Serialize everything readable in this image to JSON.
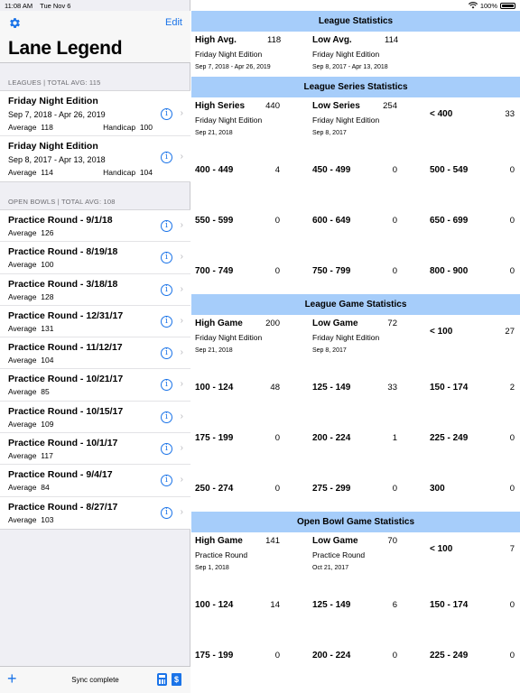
{
  "status": {
    "time": "11:08 AM",
    "date": "Tue Nov 6",
    "battery": "100%"
  },
  "sidebar": {
    "edit_label": "Edit",
    "title": "Lane Legend",
    "leagues_header": "LEAGUES | TOTAL AVG: 115",
    "leagues": [
      {
        "name": "Friday Night Edition",
        "dates": "Sep 7, 2018 - Apr 26, 2019",
        "average_label": "Average",
        "average": "118",
        "handicap_label": "Handicap",
        "handicap": "100"
      },
      {
        "name": "Friday Night Edition",
        "dates": "Sep 8, 2017 - Apr 13, 2018",
        "average_label": "Average",
        "average": "114",
        "handicap_label": "Handicap",
        "handicap": "104"
      }
    ],
    "open_header": "OPEN BOWLS | TOTAL AVG: 108",
    "open_bowls": [
      {
        "name": "Practice Round - 9/1/18",
        "average_label": "Average",
        "average": "126"
      },
      {
        "name": "Practice Round - 8/19/18",
        "average_label": "Average",
        "average": "100"
      },
      {
        "name": "Practice Round - 3/18/18",
        "average_label": "Average",
        "average": "128"
      },
      {
        "name": "Practice Round - 12/31/17",
        "average_label": "Average",
        "average": "131"
      },
      {
        "name": "Practice Round - 11/12/17",
        "average_label": "Average",
        "average": "104"
      },
      {
        "name": "Practice Round  - 10/21/17",
        "average_label": "Average",
        "average": "85"
      },
      {
        "name": "Practice Round - 10/15/17",
        "average_label": "Average",
        "average": "109"
      },
      {
        "name": "Practice Round - 10/1/17",
        "average_label": "Average",
        "average": "117"
      },
      {
        "name": "Practice Round - 9/4/17",
        "average_label": "Average",
        "average": "84"
      },
      {
        "name": "Practice Round - 8/27/17",
        "average_label": "Average",
        "average": "103"
      }
    ],
    "sync_status": "Sync complete"
  },
  "main": {
    "league_stats": {
      "title": "League Statistics",
      "high_label": "High Avg.",
      "high_value": "118",
      "high_league": "Friday Night Edition",
      "high_dates": "Sep 7, 2018 - Apr 26, 2019",
      "low_label": "Low Avg.",
      "low_value": "114",
      "low_league": "Friday Night Edition",
      "low_dates": "Sep 8, 2017 - Apr 13, 2018"
    },
    "series_stats": {
      "title": "League Series Statistics",
      "high_label": "High Series",
      "high_value": "440",
      "high_league": "Friday Night Edition",
      "high_date": "Sep 21, 2018",
      "low_label": "Low Series",
      "low_value": "254",
      "low_league": "Friday Night Edition",
      "low_date": "Sep 8, 2017",
      "first_range": {
        "label": "< 400",
        "count": "33"
      },
      "ranges": [
        {
          "label": "400 - 449",
          "count": "4"
        },
        {
          "label": "450 - 499",
          "count": "0"
        },
        {
          "label": "500 - 549",
          "count": "0"
        },
        {
          "label": "550 - 599",
          "count": "0"
        },
        {
          "label": "600 - 649",
          "count": "0"
        },
        {
          "label": "650 - 699",
          "count": "0"
        },
        {
          "label": "700 - 749",
          "count": "0"
        },
        {
          "label": "750 - 799",
          "count": "0"
        },
        {
          "label": "800 - 900",
          "count": "0"
        }
      ]
    },
    "game_stats": {
      "title": "League Game Statistics",
      "high_label": "High Game",
      "high_value": "200",
      "high_league": "Friday Night Edition",
      "high_date": "Sep 21, 2018",
      "low_label": "Low Game",
      "low_value": "72",
      "low_league": "Friday Night Edition",
      "low_date": "Sep 8, 2017",
      "first_range": {
        "label": "< 100",
        "count": "27"
      },
      "ranges": [
        {
          "label": "100 - 124",
          "count": "48"
        },
        {
          "label": "125 - 149",
          "count": "33"
        },
        {
          "label": "150 - 174",
          "count": "2"
        },
        {
          "label": "175 - 199",
          "count": "0"
        },
        {
          "label": "200 - 224",
          "count": "1"
        },
        {
          "label": "225 - 249",
          "count": "0"
        },
        {
          "label": "250 - 274",
          "count": "0"
        },
        {
          "label": "275 - 299",
          "count": "0"
        },
        {
          "label": "300",
          "count": "0"
        }
      ]
    },
    "open_stats": {
      "title": "Open Bowl Game Statistics",
      "high_label": "High Game",
      "high_value": "141",
      "high_league": "Practice Round",
      "high_date": "Sep 1, 2018",
      "low_label": "Low Game",
      "low_value": "70",
      "low_league": "Practice Round",
      "low_date": "Oct 21, 2017",
      "first_range": {
        "label": "< 100",
        "count": "7"
      },
      "ranges": [
        {
          "label": "100 - 124",
          "count": "14"
        },
        {
          "label": "125 - 149",
          "count": "6"
        },
        {
          "label": "150 - 174",
          "count": "0"
        },
        {
          "label": "175 - 199",
          "count": "0"
        },
        {
          "label": "200 - 224",
          "count": "0"
        },
        {
          "label": "225 - 249",
          "count": "0"
        }
      ]
    }
  }
}
